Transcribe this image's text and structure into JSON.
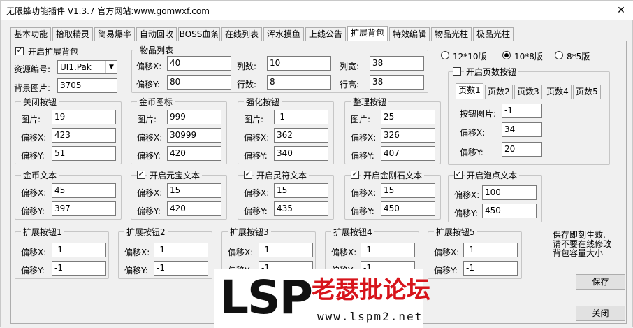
{
  "window": {
    "title": "无限蜂功能插件 V1.3.7  官方网站:www.gomwxf.com",
    "close_glyph": "✕"
  },
  "tabs": [
    "基本功能",
    "拾取精灵",
    "简易爆率",
    "自动回收",
    "BOSS血条",
    "在线列表",
    "浑水摸鱼",
    "上线公告",
    "扩展背包",
    "特效编辑",
    "物品光柱",
    "极品光柱"
  ],
  "top_left": {
    "enable_label": "开启扩展背包",
    "enable_checked": "✓",
    "resource_label": "资源编号:",
    "resource_value": "UI1.Pak",
    "dropdown_glyph": "▼",
    "bg_label": "背景图片:",
    "bg_value": "3705"
  },
  "item_list": {
    "title": "物品列表",
    "offx_label": "偏移X:",
    "offx": "40",
    "offy_label": "偏移Y:",
    "offy": "80",
    "cols_label": "列数:",
    "cols": "10",
    "rows_label": "行数:",
    "rows": "8",
    "colw_label": "列宽:",
    "colw": "38",
    "rowh_label": "行高:",
    "rowh": "38"
  },
  "layout_options": {
    "opt1": "12*10版",
    "opt2": "10*8版",
    "opt3": "8*5版",
    "selected": "10*8版"
  },
  "page_buttons": {
    "enable_label": "开启页数按钮",
    "tabs": [
      "页数1",
      "页数2",
      "页数3",
      "页数4",
      "页数5"
    ],
    "img_label": "按钮图片:",
    "img": "-1",
    "x_label": "偏移X:",
    "x": "34",
    "y_label": "偏移Y:",
    "y": "20"
  },
  "close_btn_group": {
    "title": "关闭按钮",
    "img_label": "图片:",
    "img": "19",
    "x_label": "偏移X:",
    "x": "423",
    "y_label": "偏移Y:",
    "y": "51"
  },
  "gold_icon_group": {
    "title": "金币图标",
    "img_label": "图片:",
    "img": "999",
    "x_label": "偏移X:",
    "x": "30999",
    "y_label": "偏移Y:",
    "y": "420"
  },
  "enhance_group": {
    "title": "强化按钮",
    "img_label": "图片:",
    "img": "-1",
    "x_label": "偏移X:",
    "x": "362",
    "y_label": "偏移Y:",
    "y": "340"
  },
  "sort_group": {
    "title": "整理按钮",
    "img_label": "图片:",
    "img": "25",
    "x_label": "偏移X:",
    "x": "326",
    "y_label": "偏移Y:",
    "y": "407"
  },
  "gold_text": {
    "title": "金币文本",
    "x_label": "偏移X:",
    "x": "45",
    "y_label": "偏移Y:",
    "y": "397"
  },
  "yuanbao_text": {
    "title": "开启元宝文本",
    "x_label": "偏移X:",
    "x": "15",
    "y_label": "偏移Y:",
    "y": "420"
  },
  "lingfu_text": {
    "title": "开启灵符文本",
    "x_label": "偏移X:",
    "x": "15",
    "y_label": "偏移Y:",
    "y": "435"
  },
  "diamond_text": {
    "title": "开启金刚石文本",
    "x_label": "偏移X:",
    "x": "15",
    "y_label": "偏移Y:",
    "y": "450"
  },
  "bubble_text": {
    "title": "开启泡点文本",
    "x_label": "偏移X:",
    "x": "100",
    "y_label": "偏移Y:",
    "y": "450"
  },
  "ext_btns": [
    {
      "title": "扩展按钮1",
      "x_label": "偏移X:",
      "x": "-1",
      "y_label": "偏移Y:",
      "y": "-1"
    },
    {
      "title": "扩展按钮2",
      "x_label": "偏移X:",
      "x": "-1",
      "y_label": "偏移Y:",
      "y": "-1"
    },
    {
      "title": "扩展按钮3",
      "x_label": "偏移X:",
      "x": "-1",
      "y_label": "偏移Y:",
      "y": "-1"
    },
    {
      "title": "扩展按钮4",
      "x_label": "偏移X:",
      "x": "-1",
      "y_label": "偏移Y:",
      "y": "-1"
    },
    {
      "title": "扩展按钮5",
      "x_label": "偏移X:",
      "x": "-1",
      "y_label": "偏移Y:",
      "y": "-1"
    }
  ],
  "note": {
    "line1": "保存即刻生效,",
    "line2": "请不要在线修改",
    "line3": "背包容量大小"
  },
  "buttons": {
    "save": "保存",
    "close": "关闭"
  },
  "watermark": {
    "lsp": "LSP",
    "forum": "老瑟批论坛",
    "url": "www.lspm2.net"
  }
}
